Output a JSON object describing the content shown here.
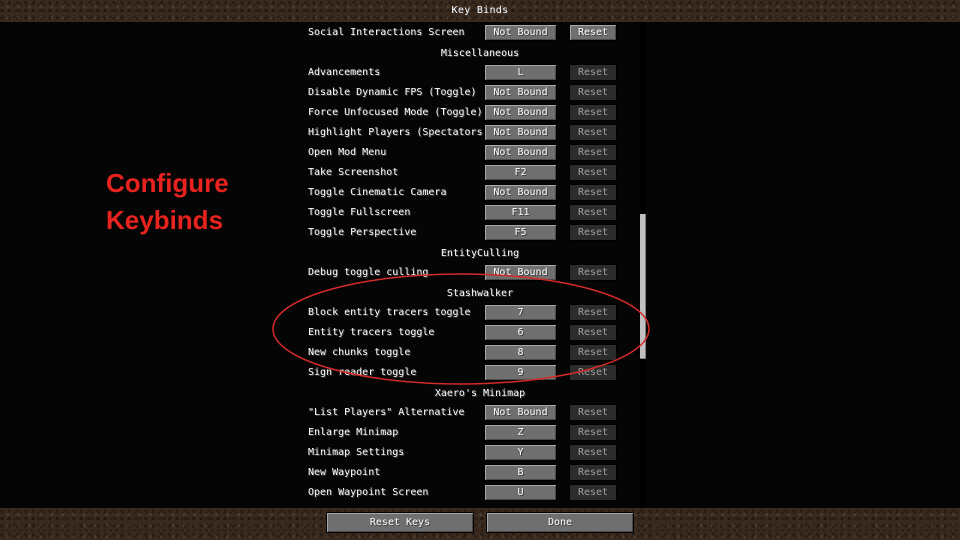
{
  "title": "Key Binds",
  "caption": {
    "line1": "Configure",
    "line2": "Keybinds"
  },
  "footer": {
    "reset_keys": "Reset Keys",
    "done": "Done"
  },
  "highlight_color": "#d42a2a",
  "entries": [
    {
      "type": "bind",
      "label": "Social Interactions Screen",
      "key": "Not Bound",
      "reset": "Reset",
      "reset_enabled": true
    },
    {
      "type": "category",
      "label": "Miscellaneous"
    },
    {
      "type": "bind",
      "label": "Advancements",
      "key": "L",
      "reset": "Reset",
      "reset_enabled": false
    },
    {
      "type": "bind",
      "label": "Disable Dynamic FPS (Toggle)",
      "key": "Not Bound",
      "reset": "Reset",
      "reset_enabled": false
    },
    {
      "type": "bind",
      "label": "Force Unfocused Mode (Toggle)",
      "key": "Not Bound",
      "reset": "Reset",
      "reset_enabled": false
    },
    {
      "type": "bind",
      "label": "Highlight Players (Spectators)",
      "key": "Not Bound",
      "reset": "Reset",
      "reset_enabled": false
    },
    {
      "type": "bind",
      "label": "Open Mod Menu",
      "key": "Not Bound",
      "reset": "Reset",
      "reset_enabled": false
    },
    {
      "type": "bind",
      "label": "Take Screenshot",
      "key": "F2",
      "reset": "Reset",
      "reset_enabled": false
    },
    {
      "type": "bind",
      "label": "Toggle Cinematic Camera",
      "key": "Not Bound",
      "reset": "Reset",
      "reset_enabled": false
    },
    {
      "type": "bind",
      "label": "Toggle Fullscreen",
      "key": "F11",
      "reset": "Reset",
      "reset_enabled": false
    },
    {
      "type": "bind",
      "label": "Toggle Perspective",
      "key": "F5",
      "reset": "Reset",
      "reset_enabled": false
    },
    {
      "type": "category",
      "label": "EntityCulling"
    },
    {
      "type": "bind",
      "label": "Debug toggle culling",
      "key": "Not Bound",
      "reset": "Reset",
      "reset_enabled": false
    },
    {
      "type": "category",
      "label": "Stashwalker"
    },
    {
      "type": "bind",
      "label": "Block entity tracers toggle",
      "key": "7",
      "reset": "Reset",
      "reset_enabled": false
    },
    {
      "type": "bind",
      "label": "Entity tracers toggle",
      "key": "6",
      "reset": "Reset",
      "reset_enabled": false
    },
    {
      "type": "bind",
      "label": "New chunks toggle",
      "key": "8",
      "reset": "Reset",
      "reset_enabled": false
    },
    {
      "type": "bind",
      "label": "Sign reader toggle",
      "key": "9",
      "reset": "Reset",
      "reset_enabled": false
    },
    {
      "type": "category",
      "label": "Xaero's Minimap"
    },
    {
      "type": "bind",
      "label": "\"List Players\" Alternative",
      "key": "Not Bound",
      "reset": "Reset",
      "reset_enabled": false
    },
    {
      "type": "bind",
      "label": "Enlarge Minimap",
      "key": "Z",
      "reset": "Reset",
      "reset_enabled": false
    },
    {
      "type": "bind",
      "label": "Minimap Settings",
      "key": "Y",
      "reset": "Reset",
      "reset_enabled": false
    },
    {
      "type": "bind",
      "label": "New Waypoint",
      "key": "B",
      "reset": "Reset",
      "reset_enabled": false
    },
    {
      "type": "bind",
      "label": "Open Waypoint Screen",
      "key": "U",
      "reset": "Reset",
      "reset_enabled": false
    }
  ]
}
